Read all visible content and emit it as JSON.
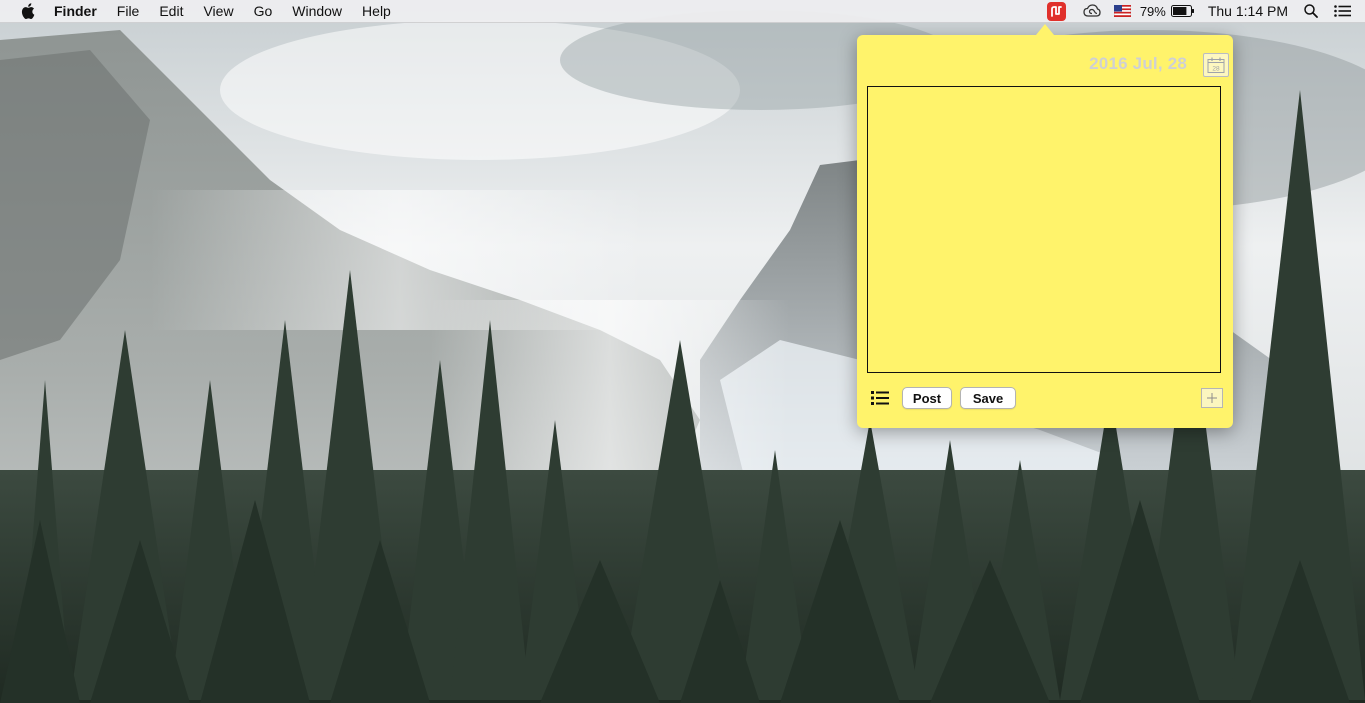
{
  "menubar": {
    "apple_icon": "apple-icon",
    "app_name": "Finder",
    "items": [
      {
        "label": "File"
      },
      {
        "label": "Edit"
      },
      {
        "label": "View"
      },
      {
        "label": "Go"
      },
      {
        "label": "Window"
      },
      {
        "label": "Help"
      }
    ],
    "status": {
      "app_icon": "note-app-icon",
      "creative_cloud_icon": "creative-cloud-icon",
      "input_source_icon": "us-flag-icon",
      "battery_percent": "79%",
      "battery_level": 0.79,
      "clock": "Thu 1:14 PM",
      "search_icon": "spotlight-search-icon",
      "notification_icon": "notification-center-icon"
    }
  },
  "popover": {
    "date": "2016 Jul, 28",
    "calendar_icon": "calendar-icon",
    "calendar_day": "28",
    "note_text": "",
    "list_icon": "list-icon",
    "post_label": "Post",
    "save_label": "Save",
    "add_icon": "plus-icon",
    "background_color": "#fff36b"
  },
  "wallpaper": {
    "description_icon": "mountain-forest-wallpaper"
  }
}
